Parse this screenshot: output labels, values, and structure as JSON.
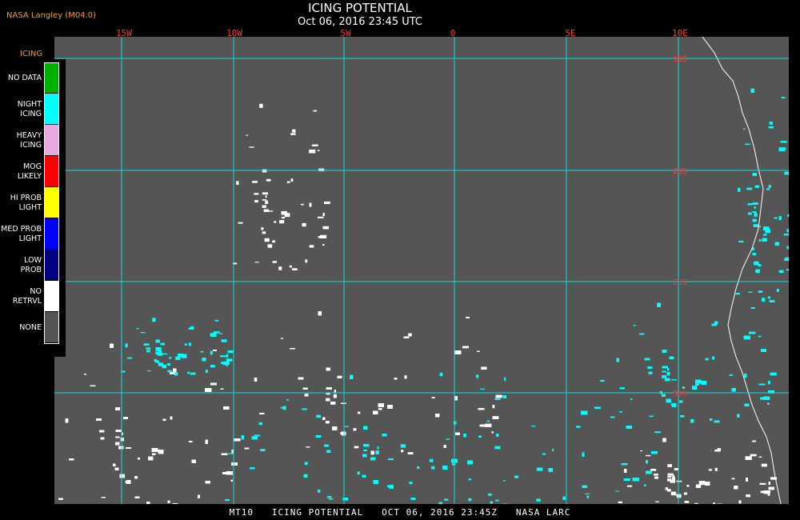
{
  "header": {
    "agency": "NASA Langley (M04.0)",
    "title": "ICING POTENTIAL",
    "datetime": "Oct 06, 2016 23:45 UTC"
  },
  "longitude_labels": [
    "15W",
    "10W",
    "5W",
    "0",
    "5E",
    "10E"
  ],
  "latitude_labels": [
    "15S",
    "20S",
    "25S",
    "30S"
  ],
  "legend": {
    "title": "ICING",
    "items": [
      {
        "label": "NO DATA",
        "color": "#00b000"
      },
      {
        "label": "NIGHT\nICING",
        "color": "#00ffff"
      },
      {
        "label": "HEAVY\nICING",
        "color": "#e8a8e0"
      },
      {
        "label": "MOG\nLIKELY",
        "color": "#ff0000"
      },
      {
        "label": "HI PROB\nLIGHT",
        "color": "#ffff00"
      },
      {
        "label": "MED PROB\nLIGHT",
        "color": "#0000ff"
      },
      {
        "label": "LOW\nPROB",
        "color": "#000080"
      },
      {
        "label": "NO\nRETRVL",
        "color": "#ffffff"
      },
      {
        "label": "NONE",
        "color": "#555555"
      }
    ]
  },
  "colors": {
    "background": "#555555",
    "grid": "#00e0e0",
    "coastline": "#ffffff",
    "night_icing": "#00ffff",
    "no_retrieval": "#ffffff"
  },
  "footer": "MT10   ICING POTENTIAL   OCT 06, 2016 23:45Z   NASA LARC"
}
